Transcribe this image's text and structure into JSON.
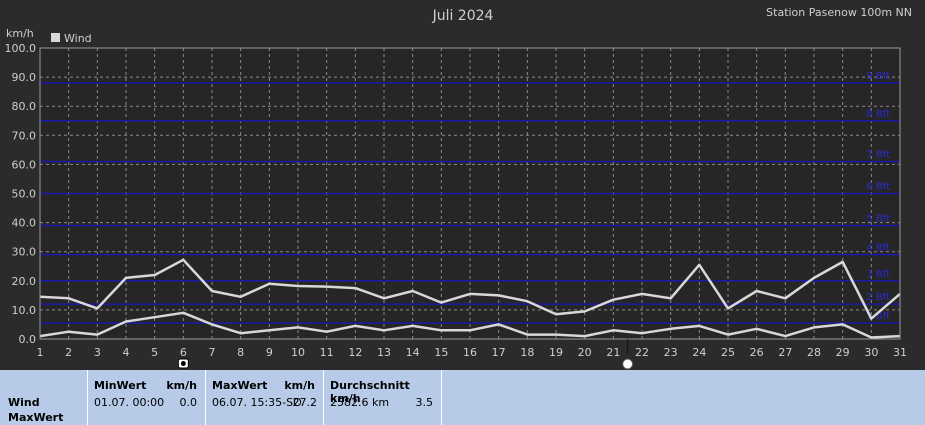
{
  "station": "Station Pasenow 100m NN",
  "chart_data": {
    "type": "line",
    "title": "Juli 2024",
    "ylabel": "km/h",
    "ylim": [
      0,
      100
    ],
    "yticks": [
      "0.0",
      "10.0",
      "20.0",
      "30.0",
      "40.0",
      "50.0",
      "60.0",
      "70.0",
      "80.0",
      "90.0",
      "100.0"
    ],
    "x": [
      1,
      2,
      3,
      4,
      5,
      6,
      7,
      8,
      9,
      10,
      11,
      12,
      13,
      14,
      15,
      16,
      17,
      18,
      19,
      20,
      21,
      22,
      23,
      24,
      25,
      26,
      27,
      28,
      29,
      30,
      31
    ],
    "grid": true,
    "legend": "top-left",
    "series": [
      {
        "name": "Wind",
        "color": "#d8d8d8",
        "values": [
          14.5,
          14,
          10.5,
          21,
          22,
          27.2,
          16.5,
          14.5,
          19,
          18.2,
          18,
          17.5,
          14,
          16.5,
          12.5,
          15.5,
          15,
          13,
          8.5,
          9.5,
          13.5,
          15.5,
          14,
          25.5,
          10.5,
          16.5,
          14,
          21,
          26.5,
          7,
          15.5
        ]
      },
      {
        "name": "",
        "color": "#d8d8d8",
        "values": [
          1,
          2.5,
          1.5,
          6,
          7.5,
          9,
          5,
          2,
          3,
          4,
          2.5,
          4.5,
          3,
          4.5,
          3,
          3,
          5,
          1.5,
          1.5,
          1,
          3,
          2,
          3.5,
          4.5,
          1.5,
          3.5,
          1,
          4,
          5,
          0.5,
          1
        ]
      }
    ],
    "bft_levels": [
      {
        "label": "1 Bft",
        "value": 5.5
      },
      {
        "label": "2 Bft",
        "value": 12
      },
      {
        "label": "3 Bft",
        "value": 20
      },
      {
        "label": "4 Bft",
        "value": 29
      },
      {
        "label": "5 Bft",
        "value": 39
      },
      {
        "label": "6 Bft",
        "value": 50
      },
      {
        "label": "7 Bft",
        "value": 61
      },
      {
        "label": "8 Bft",
        "value": 75
      },
      {
        "label": "9 Bft",
        "value": 88
      }
    ],
    "markers": [
      {
        "type": "max",
        "x": 6
      },
      {
        "type": "moon",
        "x": 21.5
      }
    ]
  },
  "footer": {
    "row_labels": [
      "Wind",
      "MaxWert"
    ],
    "min_header": "MinWert",
    "min_unit": "km/h",
    "min_date": "01.07.  00:00",
    "min_value": "0.0",
    "max_header": "MaxWert",
    "max_unit": "km/h",
    "max_date": "06.07.  15:35-SO",
    "max_value": "27.2",
    "avg_header": "Durchschnitt km/h",
    "avg_distance": "2582.6 km",
    "avg_value": "3.5"
  },
  "colors": {
    "background": "#2b2b2b",
    "plot": "#262626",
    "bft_line": "#1a1aa8",
    "footer": "#b7cbe8"
  }
}
